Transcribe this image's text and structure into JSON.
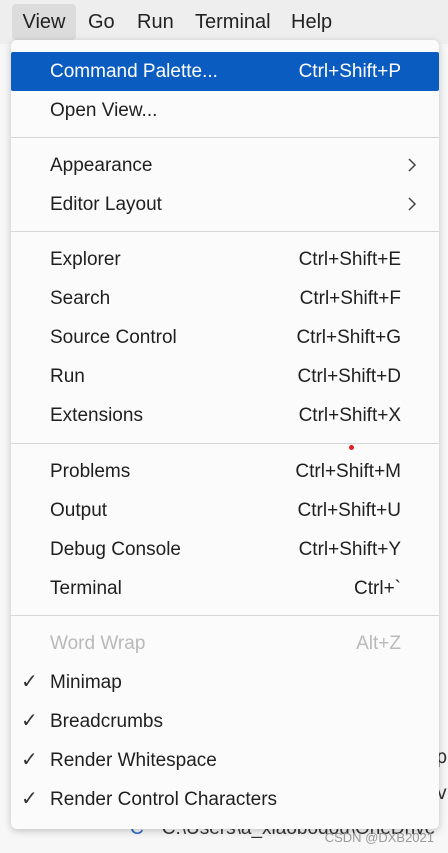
{
  "menubar": {
    "items": [
      "View",
      "Go",
      "Run",
      "Terminal",
      "Help"
    ]
  },
  "menu": {
    "group1": [
      {
        "label": "Command Palette...",
        "shortcut": "Ctrl+Shift+P"
      },
      {
        "label": "Open View...",
        "shortcut": ""
      }
    ],
    "group2": [
      {
        "label": "Appearance"
      },
      {
        "label": "Editor Layout"
      }
    ],
    "group3": [
      {
        "label": "Explorer",
        "shortcut": "Ctrl+Shift+E"
      },
      {
        "label": "Search",
        "shortcut": "Ctrl+Shift+F"
      },
      {
        "label": "Source Control",
        "shortcut": "Ctrl+Shift+G"
      },
      {
        "label": "Run",
        "shortcut": "Ctrl+Shift+D"
      },
      {
        "label": "Extensions",
        "shortcut": "Ctrl+Shift+X"
      }
    ],
    "group4": [
      {
        "label": "Problems",
        "shortcut": "Ctrl+Shift+M"
      },
      {
        "label": "Output",
        "shortcut": "Ctrl+Shift+U"
      },
      {
        "label": "Debug Console",
        "shortcut": "Ctrl+Shift+Y"
      },
      {
        "label": "Terminal",
        "shortcut": "Ctrl+`"
      }
    ],
    "group5": [
      {
        "label": "Word Wrap",
        "shortcut": "Alt+Z"
      },
      {
        "label": "Minimap"
      },
      {
        "label": "Breadcrumbs"
      },
      {
        "label": "Render Whitespace"
      },
      {
        "label": "Render Control Characters"
      }
    ],
    "check_glyph": "✓"
  },
  "background": {
    "path_glyph": "C",
    "path_text": "C:\\Users\\a_xiaobodou\\OneDrive",
    "edge_chars": [
      "p",
      "v"
    ],
    "watermark": "CSDN @DXB2021"
  },
  "colors": {
    "highlight": "#0a5cc1",
    "disabled_text": "#b9b9b9"
  }
}
